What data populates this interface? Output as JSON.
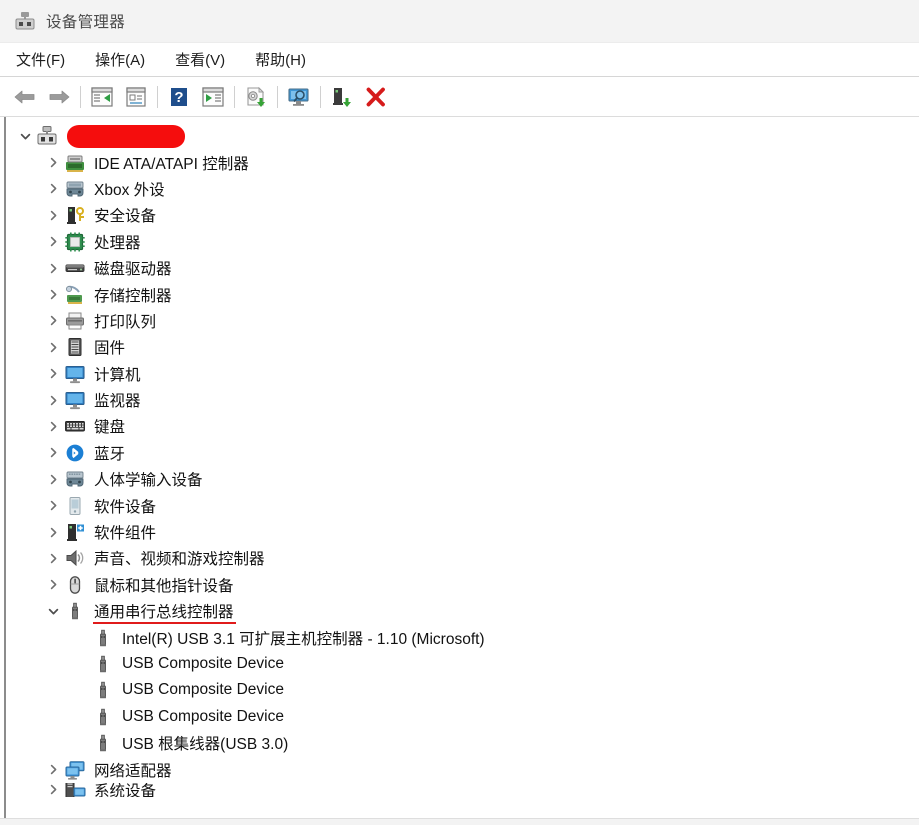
{
  "window": {
    "title": "设备管理器",
    "icon": "device-manager-icon"
  },
  "menu": {
    "items": [
      {
        "label": "文件(F)",
        "name": "menu-file"
      },
      {
        "label": "操作(A)",
        "name": "menu-action"
      },
      {
        "label": "查看(V)",
        "name": "menu-view"
      },
      {
        "label": "帮助(H)",
        "name": "menu-help"
      }
    ]
  },
  "toolbar": {
    "buttons": [
      {
        "icon": "back-arrow-icon",
        "name": "toolbar-back"
      },
      {
        "icon": "forward-arrow-icon",
        "name": "toolbar-forward"
      },
      {
        "icon": "show-hide-console-tree-icon",
        "name": "toolbar-console-tree"
      },
      {
        "icon": "properties-icon",
        "name": "toolbar-properties"
      },
      {
        "icon": "help-icon",
        "name": "toolbar-help"
      },
      {
        "icon": "show-hide-action-pane-icon",
        "name": "toolbar-action-pane"
      },
      {
        "icon": "update-driver-icon",
        "name": "toolbar-update-driver"
      },
      {
        "icon": "scan-hardware-changes-icon",
        "name": "toolbar-scan-hardware"
      },
      {
        "icon": "enable-device-icon",
        "name": "toolbar-enable-device"
      },
      {
        "icon": "uninstall-device-icon",
        "name": "toolbar-uninstall-device"
      }
    ]
  },
  "colors": {
    "redaction": "#f50d0d",
    "underline": "#e01b1b",
    "titlebar": "#f3f3f3",
    "text": "#121212"
  },
  "tree": {
    "nodes": [
      {
        "label": "",
        "redacted": true,
        "depth": 0,
        "expanded": true,
        "icon": "computer-device-icon",
        "name": "tree-root-computer"
      },
      {
        "label": "IDE ATA/ATAPI 控制器",
        "depth": 1,
        "expanded": false,
        "icon": "ide-controller-icon",
        "name": "tree-item-ide-ata-atapi"
      },
      {
        "label": "Xbox 外设",
        "depth": 1,
        "expanded": false,
        "icon": "xbox-peripheral-icon",
        "name": "tree-item-xbox"
      },
      {
        "label": "安全设备",
        "depth": 1,
        "expanded": false,
        "icon": "security-device-icon",
        "name": "tree-item-security-device"
      },
      {
        "label": "处理器",
        "depth": 1,
        "expanded": false,
        "icon": "processor-icon",
        "name": "tree-item-processor"
      },
      {
        "label": "磁盘驱动器",
        "depth": 1,
        "expanded": false,
        "icon": "disk-drive-icon",
        "name": "tree-item-disk-drive"
      },
      {
        "label": "存储控制器",
        "depth": 1,
        "expanded": false,
        "icon": "storage-controller-icon",
        "name": "tree-item-storage-controller"
      },
      {
        "label": "打印队列",
        "depth": 1,
        "expanded": false,
        "icon": "print-queue-icon",
        "name": "tree-item-print-queue"
      },
      {
        "label": "固件",
        "depth": 1,
        "expanded": false,
        "icon": "firmware-icon",
        "name": "tree-item-firmware"
      },
      {
        "label": "计算机",
        "depth": 1,
        "expanded": false,
        "icon": "computer-icon",
        "name": "tree-item-computer"
      },
      {
        "label": "监视器",
        "depth": 1,
        "expanded": false,
        "icon": "monitor-icon",
        "name": "tree-item-monitor"
      },
      {
        "label": "键盘",
        "depth": 1,
        "expanded": false,
        "icon": "keyboard-icon",
        "name": "tree-item-keyboard"
      },
      {
        "label": "蓝牙",
        "depth": 1,
        "expanded": false,
        "icon": "bluetooth-icon",
        "name": "tree-item-bluetooth"
      },
      {
        "label": "人体学输入设备",
        "depth": 1,
        "expanded": false,
        "icon": "hid-icon",
        "name": "tree-item-hid"
      },
      {
        "label": "软件设备",
        "depth": 1,
        "expanded": false,
        "icon": "software-device-icon",
        "name": "tree-item-software-device"
      },
      {
        "label": "软件组件",
        "depth": 1,
        "expanded": false,
        "icon": "software-component-icon",
        "name": "tree-item-software-component"
      },
      {
        "label": "声音、视频和游戏控制器",
        "depth": 1,
        "expanded": false,
        "icon": "sound-video-game-icon",
        "name": "tree-item-sound-video-game"
      },
      {
        "label": "鼠标和其他指针设备",
        "depth": 1,
        "expanded": false,
        "icon": "mouse-icon",
        "name": "tree-item-mouse"
      },
      {
        "label": "通用串行总线控制器",
        "depth": 1,
        "expanded": true,
        "icon": "usb-icon",
        "underlined": true,
        "name": "tree-item-usb-controllers"
      },
      {
        "label": "Intel(R) USB 3.1 可扩展主机控制器 - 1.10 (Microsoft)",
        "depth": 2,
        "icon": "usb-icon",
        "name": "tree-item-intel-usb-31-host-controller"
      },
      {
        "label": "USB Composite Device",
        "depth": 2,
        "icon": "usb-icon",
        "name": "tree-item-usb-composite-device-1"
      },
      {
        "label": "USB Composite Device",
        "depth": 2,
        "icon": "usb-icon",
        "name": "tree-item-usb-composite-device-2"
      },
      {
        "label": "USB Composite Device",
        "depth": 2,
        "icon": "usb-icon",
        "name": "tree-item-usb-composite-device-3"
      },
      {
        "label": "USB 根集线器(USB 3.0)",
        "depth": 2,
        "icon": "usb-icon",
        "name": "tree-item-usb-root-hub-30"
      },
      {
        "label": "网络适配器",
        "depth": 1,
        "expanded": false,
        "icon": "network-adapter-icon",
        "name": "tree-item-network-adapter"
      },
      {
        "label": "系统设备",
        "depth": 1,
        "expanded": false,
        "icon": "system-device-icon",
        "clipped": true,
        "name": "tree-item-system-device"
      }
    ]
  }
}
